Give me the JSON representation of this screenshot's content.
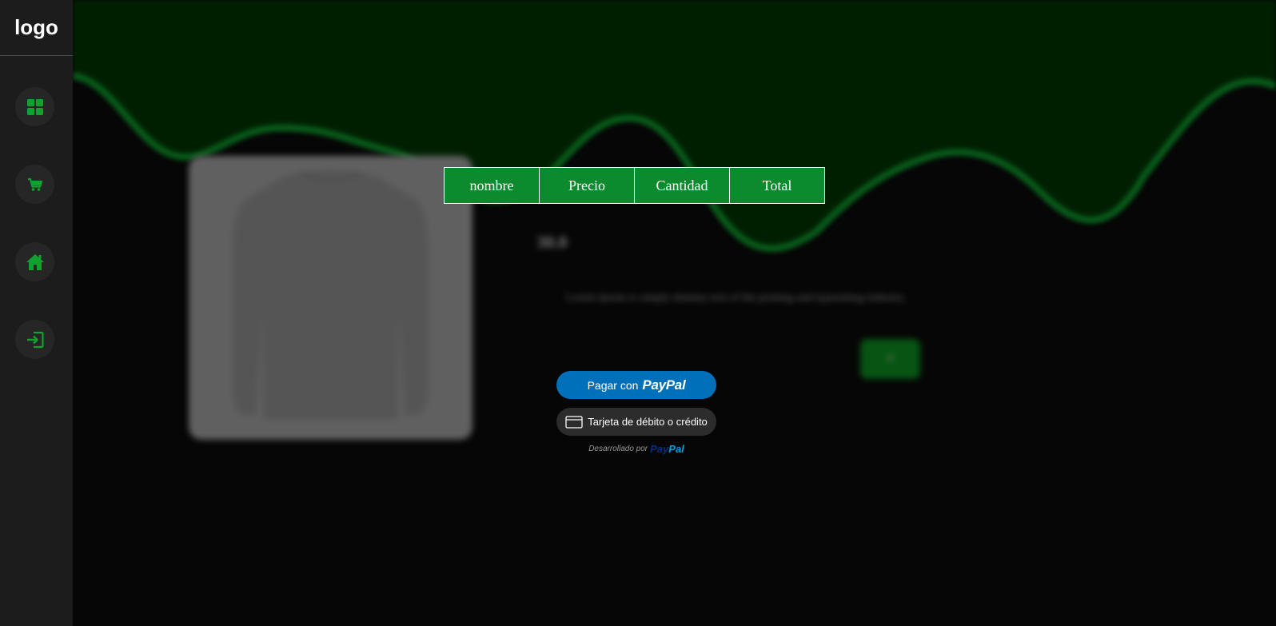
{
  "sidebar": {
    "logo": "logo",
    "items": [
      {
        "icon": "dashboard-grid-icon"
      },
      {
        "icon": "shopping-cart-icon"
      },
      {
        "icon": "home-icon"
      },
      {
        "icon": "login-icon"
      }
    ],
    "accent_color": "#0fa22e"
  },
  "cart": {
    "columns": [
      "nombre",
      "Precio",
      "Cantidad",
      "Total"
    ],
    "header_color": "#0c8a2e"
  },
  "product": {
    "price": "30.0",
    "description": "Lorem Ipsum is simply dummy text of the printing and typesetting industry.",
    "button_label": "+"
  },
  "payment": {
    "paypal_button_prefix": "Pagar con",
    "paypal_wordmark": "PayPal",
    "card_button_label": "Tarjeta de débito o crédito",
    "powered_by_text": "Desarrollado por",
    "powered_logo_pay": "Pay",
    "powered_logo_pal": "Pal",
    "paypal_color": "#0070ba"
  }
}
